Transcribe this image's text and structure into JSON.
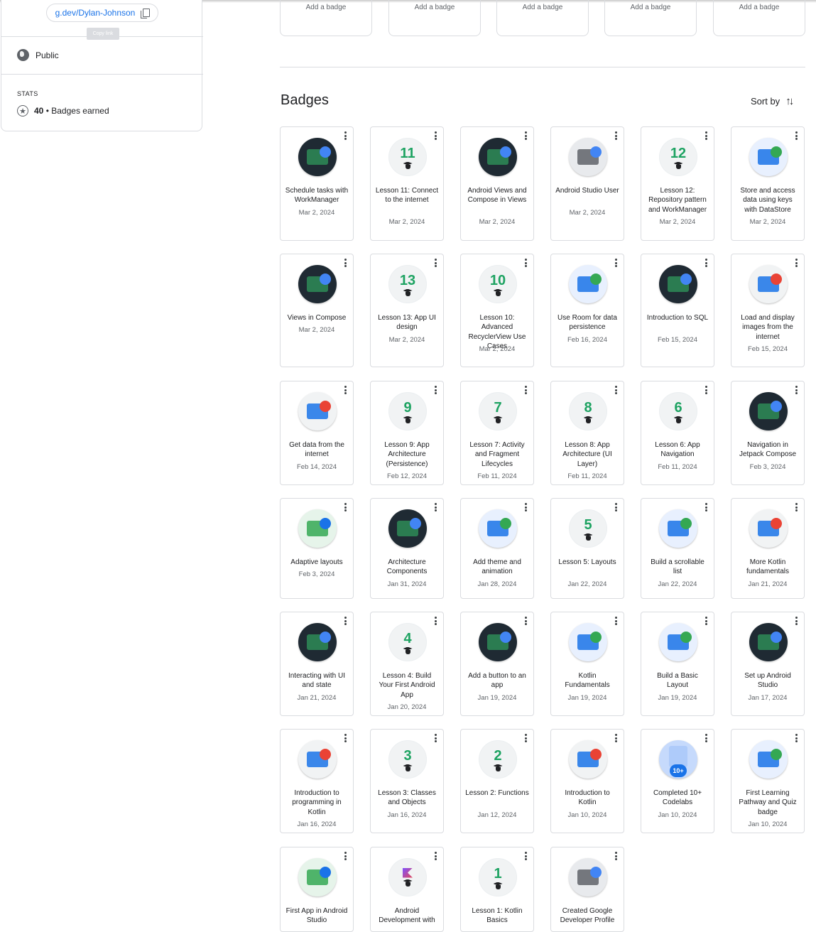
{
  "profile": {
    "link_text": "g.dev/Dylan-Johnson",
    "copy_tooltip": "Copy link",
    "visibility": "Public",
    "stats_label": "STATS",
    "badges_count": "40",
    "badges_earned_label": "• Badges earned"
  },
  "add_badge_slots": [
    "Add a badge",
    "Add a badge",
    "Add a badge",
    "Add a badge",
    "Add a badge"
  ],
  "badges_section": {
    "title": "Badges",
    "sort_label": "Sort by"
  },
  "colors": {
    "accent": "#1a73e8",
    "lesson_green": "#1ea362",
    "border": "#dadce0",
    "dark_badge": "#1f2a33"
  },
  "badges": [
    {
      "name": "Schedule tasks with WorkManager",
      "date": "Mar 2, 2024",
      "icon": "workmanager-badge-icon",
      "kind": "dark"
    },
    {
      "name": "Lesson 11: Connect to the internet",
      "date": "Mar 2, 2024",
      "icon": "lesson-badge-icon",
      "kind": "lesson",
      "num": "11"
    },
    {
      "name": "Android Views and Compose in Views",
      "date": "Mar 2, 2024",
      "icon": "views-compose-badge-icon",
      "kind": "dark"
    },
    {
      "name": "Android Studio User",
      "date": "Mar 2, 2024",
      "icon": "android-studio-badge-icon",
      "kind": "grey"
    },
    {
      "name": "Lesson 12: Repository pattern and WorkManager",
      "date": "Mar 2, 2024",
      "icon": "lesson-badge-icon",
      "kind": "lesson",
      "num": "12"
    },
    {
      "name": "Store and access data using keys with DataStore",
      "date": "Mar 2, 2024",
      "icon": "datastore-badge-icon",
      "kind": "blue"
    },
    {
      "name": "Views in Compose",
      "date": "Mar 2, 2024",
      "icon": "views-in-compose-badge-icon",
      "kind": "dark"
    },
    {
      "name": "Lesson 13: App UI design",
      "date": "Mar 2, 2024",
      "icon": "lesson-badge-icon",
      "kind": "lesson",
      "num": "13"
    },
    {
      "name": "Lesson 10: Advanced RecyclerView Use Cases",
      "date": "Mar 2, 2024",
      "icon": "lesson-badge-icon",
      "kind": "lesson",
      "num": "10"
    },
    {
      "name": "Use Room for data persistence",
      "date": "Feb 16, 2024",
      "icon": "room-badge-icon",
      "kind": "blue"
    },
    {
      "name": "Introduction to SQL",
      "date": "Feb 15, 2024",
      "icon": "sql-badge-icon",
      "kind": "dark"
    },
    {
      "name": "Load and display images from the internet",
      "date": "Feb 15, 2024",
      "icon": "images-badge-icon",
      "kind": "light"
    },
    {
      "name": "Get data from the internet",
      "date": "Feb 14, 2024",
      "icon": "internet-data-badge-icon",
      "kind": "light"
    },
    {
      "name": "Lesson 9: App Architecture (Persistence)",
      "date": "Feb 12, 2024",
      "icon": "lesson-badge-icon",
      "kind": "lesson",
      "num": "9"
    },
    {
      "name": "Lesson 7: Activity and Fragment Lifecycles",
      "date": "Feb 11, 2024",
      "icon": "lesson-badge-icon",
      "kind": "lesson",
      "num": "7"
    },
    {
      "name": "Lesson 8: App Architecture (UI Layer)",
      "date": "Feb 11, 2024",
      "icon": "lesson-badge-icon",
      "kind": "lesson",
      "num": "8"
    },
    {
      "name": "Lesson 6: App Navigation",
      "date": "Feb 11, 2024",
      "icon": "lesson-badge-icon",
      "kind": "lesson",
      "num": "6"
    },
    {
      "name": "Navigation in Jetpack Compose",
      "date": "Feb 3, 2024",
      "icon": "navigation-badge-icon",
      "kind": "dark"
    },
    {
      "name": "Adaptive layouts",
      "date": "Feb 3, 2024",
      "icon": "adaptive-layouts-badge-icon",
      "kind": "green"
    },
    {
      "name": "Architecture Components",
      "date": "Jan 31, 2024",
      "icon": "architecture-badge-icon",
      "kind": "dark"
    },
    {
      "name": "Add theme and animation",
      "date": "Jan 28, 2024",
      "icon": "theme-animation-badge-icon",
      "kind": "blue"
    },
    {
      "name": "Lesson 5: Layouts",
      "date": "Jan 22, 2024",
      "icon": "lesson-badge-icon",
      "kind": "lesson",
      "num": "5"
    },
    {
      "name": "Build a scrollable list",
      "date": "Jan 22, 2024",
      "icon": "scrollable-list-badge-icon",
      "kind": "blue"
    },
    {
      "name": "More Kotlin fundamentals",
      "date": "Jan 21, 2024",
      "icon": "kotlin-more-badge-icon",
      "kind": "light"
    },
    {
      "name": "Interacting with UI and state",
      "date": "Jan 21, 2024",
      "icon": "ui-state-badge-icon",
      "kind": "dark"
    },
    {
      "name": "Lesson 4: Build Your First Android App",
      "date": "Jan 20, 2024",
      "icon": "lesson-badge-icon",
      "kind": "lesson",
      "num": "4"
    },
    {
      "name": "Add a button to an app",
      "date": "Jan 19, 2024",
      "icon": "button-app-badge-icon",
      "kind": "dark"
    },
    {
      "name": "Kotlin Fundamentals",
      "date": "Jan 19, 2024",
      "icon": "kotlin-fundamentals-badge-icon",
      "kind": "blue"
    },
    {
      "name": "Build a Basic Layout",
      "date": "Jan 19, 2024",
      "icon": "basic-layout-badge-icon",
      "kind": "blue"
    },
    {
      "name": "Set up Android Studio",
      "date": "Jan 17, 2024",
      "icon": "setup-studio-badge-icon",
      "kind": "dark"
    },
    {
      "name": "Introduction to programming in Kotlin",
      "date": "Jan 16, 2024",
      "icon": "intro-programming-badge-icon",
      "kind": "light"
    },
    {
      "name": "Lesson 3: Classes and Objects",
      "date": "Jan 16, 2024",
      "icon": "lesson-badge-icon",
      "kind": "lesson",
      "num": "3"
    },
    {
      "name": "Lesson 2: Functions",
      "date": "Jan 12, 2024",
      "icon": "lesson-badge-icon",
      "kind": "lesson",
      "num": "2"
    },
    {
      "name": "Introduction to Kotlin",
      "date": "Jan 10, 2024",
      "icon": "intro-kotlin-badge-icon",
      "kind": "light"
    },
    {
      "name": "Completed 10+ Codelabs",
      "date": "Jan 10, 2024",
      "icon": "codelabs-badge-icon",
      "kind": "codelab",
      "num": "10+"
    },
    {
      "name": "First Learning Pathway and Quiz badge",
      "date": "Jan 10, 2024",
      "icon": "pathway-badge-icon",
      "kind": "blue"
    },
    {
      "name": "First App in Android Studio",
      "date": "",
      "icon": "first-app-badge-icon",
      "kind": "green"
    },
    {
      "name": "Android Development with",
      "date": "",
      "icon": "android-dev-badge-icon",
      "kind": "lesson-k"
    },
    {
      "name": "Lesson 1: Kotlin Basics",
      "date": "",
      "icon": "lesson-badge-icon",
      "kind": "lesson",
      "num": "1"
    },
    {
      "name": "Created Google Developer Profile",
      "date": "",
      "icon": "developer-profile-badge-icon",
      "kind": "grey"
    }
  ]
}
